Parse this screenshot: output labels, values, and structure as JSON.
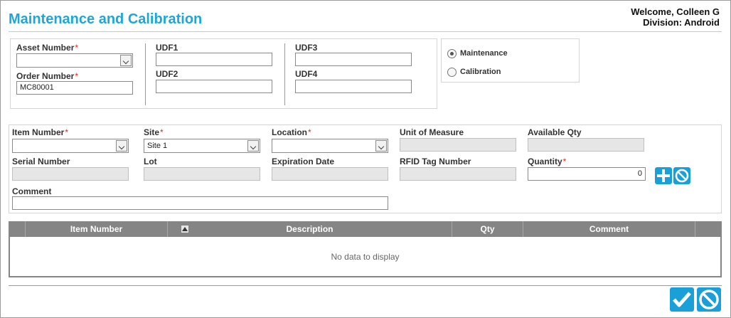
{
  "page": {
    "title": "Maintenance and Calibration"
  },
  "user": {
    "welcome": "Welcome, Colleen G",
    "division": "Division: Android"
  },
  "header": {
    "asset_number_label": "Asset Number",
    "asset_number_value": "",
    "order_number_label": "Order Number",
    "order_number_value": "MC80001",
    "udf1_label": "UDF1",
    "udf1_value": "",
    "udf2_label": "UDF2",
    "udf2_value": "",
    "udf3_label": "UDF3",
    "udf3_value": "",
    "udf4_label": "UDF4",
    "udf4_value": ""
  },
  "mode": {
    "maintenance_label": "Maintenance",
    "calibration_label": "Calibration",
    "selected": "Maintenance"
  },
  "item": {
    "item_number_label": "Item Number",
    "item_number_value": "",
    "site_label": "Site",
    "site_value": "Site 1",
    "location_label": "Location",
    "location_value": "",
    "uom_label": "Unit of Measure",
    "uom_value": "",
    "available_qty_label": "Available Qty",
    "available_qty_value": "",
    "serial_label": "Serial Number",
    "serial_value": "",
    "lot_label": "Lot",
    "lot_value": "",
    "expiration_label": "Expiration Date",
    "expiration_value": "",
    "rfid_label": "RFID Tag Number",
    "rfid_value": "",
    "quantity_label": "Quantity",
    "quantity_value": "0",
    "comment_label": "Comment",
    "comment_value": ""
  },
  "grid": {
    "columns": [
      "Item Number",
      "Description",
      "Qty",
      "Comment"
    ],
    "empty_text": "No data to display"
  },
  "colors": {
    "accent": "#1ba8d8",
    "button": "#1aa0d8",
    "required": "#d9281e",
    "grid_header": "#858585"
  }
}
